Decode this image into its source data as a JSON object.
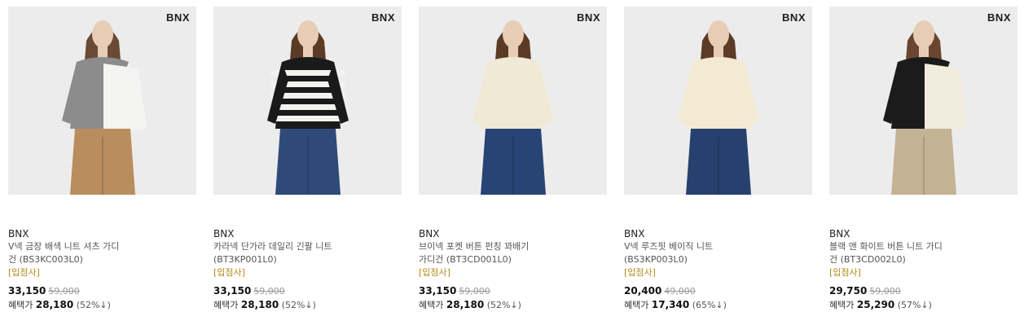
{
  "products": [
    {
      "logo": "BNX",
      "brand": "BNX",
      "name_line1": "V넥 금장 배색 니트 셔츠 가디",
      "name_line2": "건 (BS3KC003L0)",
      "shop": "[입점사]",
      "price": "33,150",
      "original_price": "59,000",
      "benefit_label": "혜택가",
      "benefit_price": "28,180",
      "benefit_rate": "(52%↓)",
      "colors": {
        "bg": "#ececec",
        "top": "#8c8c8c",
        "accent": "#f4f4f2",
        "bottom": "#b98d5e",
        "hair": "#6a4a34"
      }
    },
    {
      "logo": "BNX",
      "brand": "BNX",
      "name_line1": "카라넥 단가라 데일리 긴팔 니트",
      "name_line2": "(BT3KP001L0)",
      "shop": "[입점사]",
      "price": "33,150",
      "original_price": "59,000",
      "benefit_label": "혜택가",
      "benefit_price": "28,180",
      "benefit_rate": "(52%↓)",
      "colors": {
        "bg": "#ececec",
        "top": "#1a1a1a",
        "accent": "#f2f2ef",
        "bottom": "#2f4a78",
        "hair": "#5b3a26"
      }
    },
    {
      "logo": "BNX",
      "brand": "BNX",
      "name_line1": "브이넥 포켓 버튼 펀칭 꽈배기",
      "name_line2": "가디건 (BT3CD001L0)",
      "shop": "[입점사]",
      "price": "33,150",
      "original_price": "59,000",
      "benefit_label": "혜택가",
      "benefit_price": "28,180",
      "benefit_rate": "(52%↓)",
      "colors": {
        "bg": "#ececec",
        "top": "#efe9d6",
        "accent": "#c7b29b",
        "bottom": "#284476",
        "hair": "#5b3a26"
      }
    },
    {
      "logo": "BNX",
      "brand": "BNX",
      "name_line1": "V넥 루즈핏 베이직 니트",
      "name_line2": "(BS3KP003L0)",
      "shop": "[입점사]",
      "price": "20,400",
      "original_price": "49,000",
      "benefit_label": "혜택가",
      "benefit_price": "17,340",
      "benefit_rate": "(65%↓)",
      "colors": {
        "bg": "#ececec",
        "top": "#f3ead3",
        "accent": "#efe4c9",
        "bottom": "#27416f",
        "hair": "#5b3a26"
      }
    },
    {
      "logo": "BNX",
      "brand": "BNX",
      "name_line1": "블랙 앤 화이트 버튼 니트 가디",
      "name_line2": "건 (BT3CD002L0)",
      "shop": "[입점사]",
      "price": "29,750",
      "original_price": "59,000",
      "benefit_label": "혜택가",
      "benefit_price": "25,290",
      "benefit_rate": "(57%↓)",
      "colors": {
        "bg": "#ececec",
        "top": "#1b1b1b",
        "accent": "#f1ecde",
        "bottom": "#c4b294",
        "hair": "#6a4530"
      }
    }
  ]
}
